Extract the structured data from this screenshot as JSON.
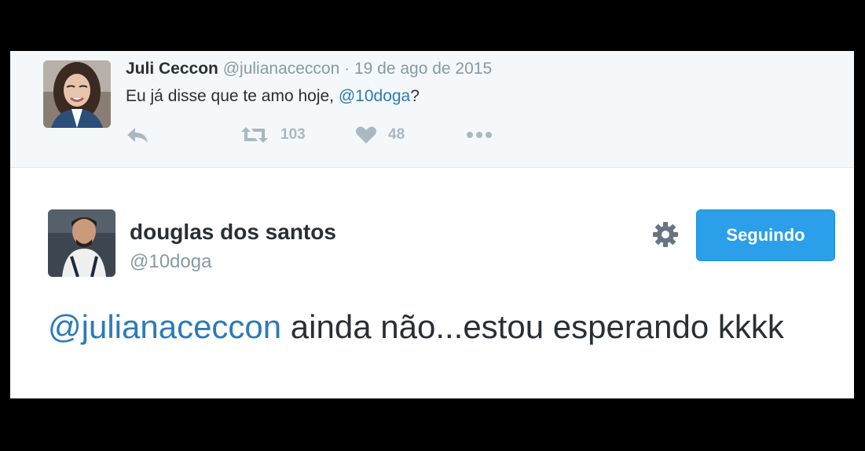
{
  "reply": {
    "name": "Juli Ceccon",
    "handle": "@julianaceccon",
    "separator": "·",
    "date": "19 de ago de 2015",
    "text_before": "Eu já disse que te amo hoje, ",
    "text_mention": "@10doga",
    "text_after": "?",
    "retweets": "103",
    "likes": "48",
    "icons": [
      "reply-icon",
      "retweet-icon",
      "heart-icon",
      "more-icon"
    ]
  },
  "main": {
    "name": "douglas dos santos",
    "handle": "@10doga",
    "follow_label": "Seguindo",
    "text_mention": "@julianaceccon",
    "text_body": " ainda não...estou esperando kkkk",
    "icons": [
      "gear-icon"
    ]
  },
  "colors": {
    "link": "#2b7bb9",
    "button": "#2b9fea",
    "muted": "#8899a6",
    "text": "#292f33",
    "background": "#000000"
  }
}
